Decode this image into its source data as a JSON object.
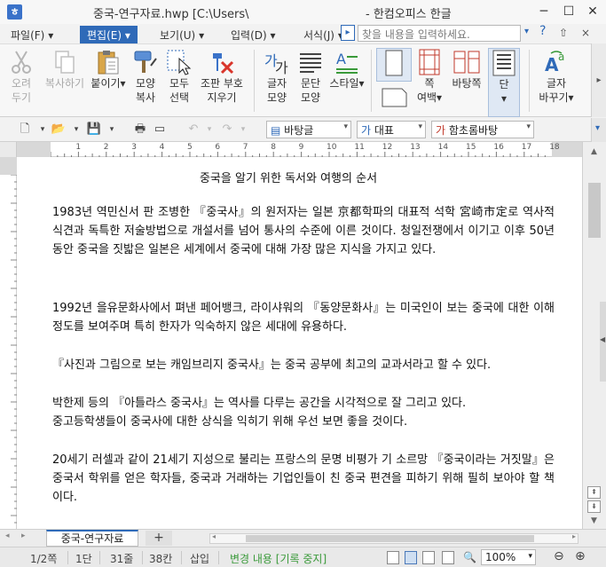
{
  "window": {
    "app_icon": "ㅎ",
    "title": "중국-연구자료.hwp [C:\\Users\\",
    "app_name": "- 한컴오피스 한글",
    "minimize": "─",
    "maximize": "☐",
    "close": "✕"
  },
  "menubar": {
    "items": [
      {
        "label": "파일(F)"
      },
      {
        "label": "편집(E)"
      },
      {
        "label": "보기(U)"
      },
      {
        "label": "입력(D)"
      },
      {
        "label": "서식(J)"
      }
    ],
    "item_arrows": [
      "▾",
      "▾",
      "▾",
      "▾",
      "▾"
    ],
    "more": "▸",
    "search_placeholder": "찾을 내용을 입력하세요.",
    "search_dropdown": "▾",
    "help": "?",
    "mini_close": "×",
    "mini_restore": "⇧"
  },
  "ribbon": {
    "buttons": [
      {
        "label1": "오려",
        "label2": "두기",
        "icon": "scissors-icon",
        "disabled": true
      },
      {
        "label1": "복사하기",
        "label2": "",
        "icon": "copy-icon",
        "disabled": true
      },
      {
        "label1": "붙이기",
        "label2": "",
        "icon": "paste-icon",
        "disabled": false
      },
      {
        "label1": "모양",
        "label2": "복사",
        "icon": "format-painter-icon",
        "disabled": false
      },
      {
        "label1": "모두",
        "label2": "선택",
        "icon": "select-all-icon",
        "disabled": false
      },
      {
        "label1": "조판 부호",
        "label2": "지우기",
        "icon": "clear-marks-icon",
        "disabled": false
      },
      {
        "label1": "글자",
        "label2": "모양",
        "icon": "char-shape-icon",
        "disabled": false
      },
      {
        "label1": "문단",
        "label2": "모양",
        "icon": "para-shape-icon",
        "disabled": false
      },
      {
        "label1": "스타일",
        "label2": "",
        "icon": "style-icon",
        "disabled": false
      },
      {
        "label1": "",
        "label2": "",
        "icon": "page-portrait-icon",
        "disabled": false
      },
      {
        "label1": "쪽",
        "label2": "여백",
        "icon": "page-margin-icon",
        "disabled": false
      },
      {
        "label1": "바탕쪽",
        "label2": "",
        "icon": "master-page-icon",
        "disabled": false
      },
      {
        "label1": "단",
        "label2": "",
        "icon": "columns-icon",
        "disabled": false
      },
      {
        "label1": "글자",
        "label2": "바꾸기",
        "icon": "replace-char-icon",
        "disabled": false
      }
    ],
    "paste_arrow": "▾",
    "margin_arrow": "▾",
    "column_arrow": "▾",
    "replace_arrow": "▾",
    "expand": "▸"
  },
  "toolbar2": {
    "new_doc": "🗋",
    "open": "📂",
    "save": "💾",
    "print": "🖶",
    "preview": "▭",
    "undo": "↶",
    "redo": "↷",
    "dropdown": "▾",
    "style_combo": "바탕글",
    "lang_combo": "대표",
    "font_combo": "함초롬바탕",
    "style_icon": "▤",
    "lang_icon": "가",
    "font_icon": "가",
    "more": "▾"
  },
  "ruler": {
    "numbers": [
      "1",
      "2",
      "3",
      "4",
      "5",
      "6",
      "7",
      "8",
      "9",
      "10",
      "11",
      "12",
      "13",
      "14",
      "15",
      "16",
      "17",
      "18"
    ]
  },
  "document": {
    "title": "중국을 알기 위한 독서와 여행의 순서",
    "paragraphs": [
      "1983년 역민신서 판 조병한 『중국사』의 원저자는 일본 京都학파의 대표적 석학 宮崎市定로 역사적 식견과  독특한 저술방법으로 개설서를 넘어 통사의 수준에 이른 것이다. 청일전쟁에서 이기고 이후 50년 동안 중국을 짓밟은 일본은 세계에서 중국에 대해 가장 많은 지식을 가지고 있다.",
      "1992년 을유문화사에서 펴낸 페어뱅크, 라이샤워의 『동양문화사』는 미국인이 보는 중국에 대한 이해정도를 보여주며 특히 한자가 익숙하지 않은 세대에 유용하다.",
      "『사진과 그림으로 보는 캐임브리지 중국사』는 중국 공부에 최고의 교과서라고 할 수 있다.",
      "박한제 등의 『아틀라스 중국사』는 역사를 다루는 공간을 시각적으로 잘 그리고 있다.",
      "   중고등학생들이 중국사에 대한 상식을 익히기 위해 우선 보면 좋을 것이다.",
      "20세기 러셀과 같이 21세기 지성으로 불리는 프랑스의 문명 비평가 기 소르망 『중국이라는 거짓말』은 중국서 학위를 얻은 학자들, 중국과 거래하는 기업인들이 친 중국 편견을 피하기 위해 필히 보아야 할 책이다."
    ]
  },
  "scrollbar": {
    "up": "▲",
    "down": "▼",
    "side_arrow": "◀",
    "page_prev": "⇞",
    "page_next": "⇟"
  },
  "tabs": {
    "nav": [
      "◂",
      "▸"
    ],
    "document_tab": "중국-연구자료",
    "add_tab": "+",
    "scroll_left": "◂",
    "scroll_right": "▸"
  },
  "status": {
    "page": "1/2쪽",
    "column": "1단",
    "line": "31줄",
    "col_pos": "38칸",
    "insert_mode": "삽입",
    "track_changes": "변경 내용 [기록 중지]",
    "zoom": "100%",
    "zoom_dropdown": "▾",
    "zoom_out": "⊖",
    "zoom_in": "⊕",
    "zoom_icon": "🔍"
  },
  "colors": {
    "accent": "#2f6ab8",
    "status_green": "#3a9a3a"
  }
}
